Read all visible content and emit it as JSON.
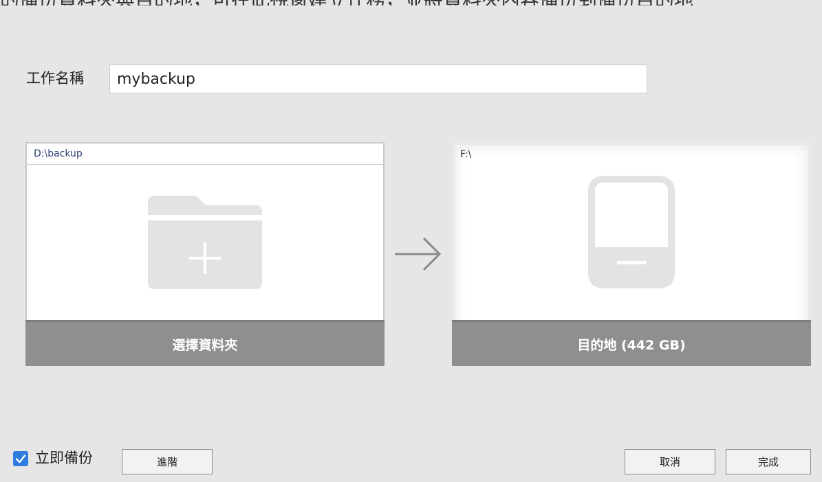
{
  "top_cutoff_text": "的備份資料夾與目的地，可在此視窗建立任務，並將資料夾內容備份到備份目的地",
  "job": {
    "label": "工作名稱",
    "value": "mybackup"
  },
  "source": {
    "path": "D:\\backup",
    "footer_label": "選擇資料夾",
    "icon": "folder-add-icon"
  },
  "destination": {
    "path": "F:\\",
    "footer_label": "目的地 (442 GB)",
    "icon": "external-drive-icon"
  },
  "arrow_icon": "arrow-right-icon",
  "bottom": {
    "backup_now_label": "立即備份",
    "backup_now_checked": true,
    "advanced_label": "進階",
    "cancel_label": "取消",
    "finish_label": "完成"
  },
  "colors": {
    "background": "#e6e6e6",
    "footer_bar": "#8f8f8f",
    "checkbox_accent": "#2f7de1",
    "path_text": "#2a3f73",
    "icon_gray": "#e3e3e3"
  }
}
